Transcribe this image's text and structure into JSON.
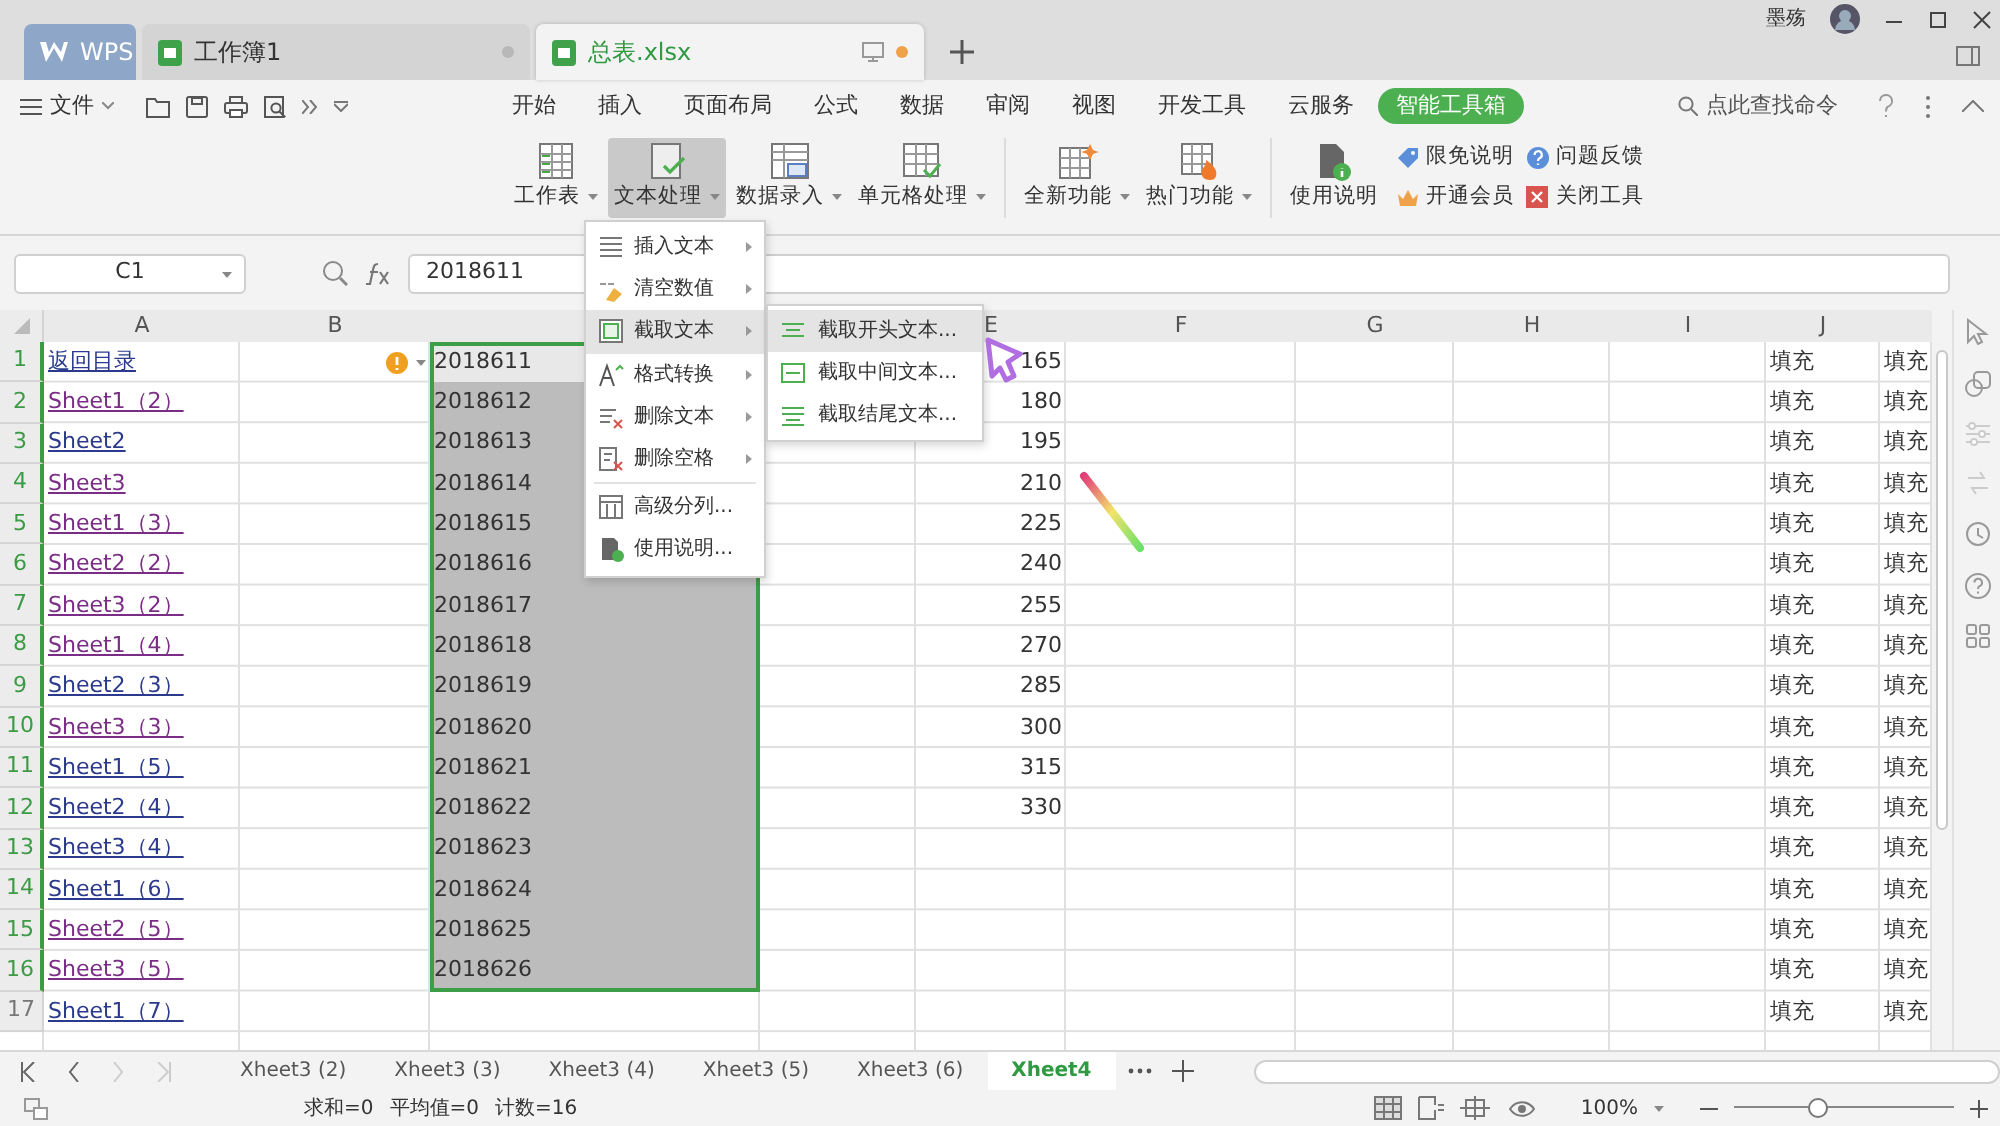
{
  "app_tabs": [
    {
      "label": "WPS",
      "kind": "home",
      "selected": false
    },
    {
      "label": "工作簿1",
      "kind": "doc",
      "selected": false,
      "unsaved": false
    },
    {
      "label": "总表.xlsx",
      "kind": "doc",
      "selected": true,
      "unsaved": true
    }
  ],
  "user": {
    "name": "墨殇"
  },
  "file_menu": {
    "label": "文件"
  },
  "ribbon_tabs": [
    {
      "label": "开始",
      "selected": false
    },
    {
      "label": "插入",
      "selected": false
    },
    {
      "label": "页面布局",
      "selected": false
    },
    {
      "label": "公式",
      "selected": false
    },
    {
      "label": "数据",
      "selected": false
    },
    {
      "label": "审阅",
      "selected": false
    },
    {
      "label": "视图",
      "selected": false
    },
    {
      "label": "开发工具",
      "selected": false
    },
    {
      "label": "云服务",
      "selected": false
    },
    {
      "label": "智能工具箱",
      "selected": true
    }
  ],
  "search": {
    "placeholder": "点此查找命令"
  },
  "ribbon_groups": [
    {
      "buttons": [
        {
          "label": "工作表",
          "kind": "sheet",
          "dropdown": true,
          "selected": false
        },
        {
          "label": "文本处理",
          "kind": "text",
          "dropdown": true,
          "selected": true
        },
        {
          "label": "数据录入",
          "kind": "entry",
          "dropdown": true,
          "selected": false
        },
        {
          "label": "单元格处理",
          "kind": "cell",
          "dropdown": true,
          "selected": false
        }
      ]
    },
    {
      "buttons": [
        {
          "label": "全新功能",
          "kind": "new",
          "dropdown": true,
          "selected": false
        },
        {
          "label": "热门功能",
          "kind": "hot",
          "dropdown": true,
          "selected": false
        }
      ]
    },
    {
      "buttons": [
        {
          "label": "使用说明",
          "kind": "help",
          "dropdown": false,
          "selected": false
        }
      ],
      "links": [
        {
          "label": "限免说明",
          "kind": "tag"
        },
        {
          "label": "问题反馈",
          "kind": "question"
        },
        {
          "label": "开通会员",
          "kind": "crown"
        },
        {
          "label": "关闭工具",
          "kind": "close"
        }
      ]
    }
  ],
  "formula_bar": {
    "cell": "C1",
    "value": "2018611"
  },
  "columns": [
    {
      "label": "A"
    },
    {
      "label": "B"
    },
    {},
    {},
    {
      "label": "E"
    },
    {
      "label": "F"
    },
    {
      "label": "G"
    },
    {
      "label": "H"
    },
    {
      "label": "I"
    },
    {
      "label": "J"
    },
    {}
  ],
  "rows": [
    {
      "number": "1",
      "selected": true,
      "cells": {
        "A": {
          "text": "返回目录",
          "visited": false
        },
        "C": "2018611",
        "E": "165",
        "J": "填充",
        "K": "填充"
      }
    },
    {
      "number": "2",
      "selected": true,
      "cells": {
        "A": {
          "text": "Sheet1（2）",
          "visited": true
        },
        "C": "2018612",
        "E": "180",
        "J": "填充",
        "K": "填充"
      }
    },
    {
      "number": "3",
      "selected": true,
      "cells": {
        "A": {
          "text": "Sheet2",
          "visited": false
        },
        "C": "2018613",
        "E": "195",
        "J": "填充",
        "K": "填充"
      }
    },
    {
      "number": "4",
      "selected": true,
      "cells": {
        "A": {
          "text": "Sheet3",
          "visited": true
        },
        "C": "2018614",
        "E": "210",
        "J": "填充",
        "K": "填充"
      }
    },
    {
      "number": "5",
      "selected": true,
      "cells": {
        "A": {
          "text": "Sheet1（3）",
          "visited": true
        },
        "C": "2018615",
        "E": "225",
        "J": "填充",
        "K": "填充"
      }
    },
    {
      "number": "6",
      "selected": true,
      "cells": {
        "A": {
          "text": "Sheet2（2）",
          "visited": true
        },
        "C": "2018616",
        "E": "240",
        "J": "填充",
        "K": "填充"
      }
    },
    {
      "number": "7",
      "selected": true,
      "cells": {
        "A": {
          "text": "Sheet3（2）",
          "visited": true
        },
        "C": "2018617",
        "E": "255",
        "J": "填充",
        "K": "填充"
      }
    },
    {
      "number": "8",
      "selected": true,
      "cells": {
        "A": {
          "text": "Sheet1（4）",
          "visited": true
        },
        "C": "2018618",
        "E": "270",
        "J": "填充",
        "K": "填充"
      }
    },
    {
      "number": "9",
      "selected": true,
      "cells": {
        "A": {
          "text": "Sheet2（3）",
          "visited": false
        },
        "C": "2018619",
        "E": "285",
        "J": "填充",
        "K": "填充"
      }
    },
    {
      "number": "10",
      "selected": true,
      "cells": {
        "A": {
          "text": "Sheet3（3）",
          "visited": true
        },
        "C": "2018620",
        "E": "300",
        "J": "填充",
        "K": "填充"
      }
    },
    {
      "number": "11",
      "selected": true,
      "cells": {
        "A": {
          "text": "Sheet1（5）",
          "visited": false
        },
        "C": "2018621",
        "E": "315",
        "J": "填充",
        "K": "填充"
      }
    },
    {
      "number": "12",
      "selected": true,
      "cells": {
        "A": {
          "text": "Sheet2（4）",
          "visited": false
        },
        "C": "2018622",
        "E": "330",
        "J": "填充",
        "K": "填充"
      }
    },
    {
      "number": "13",
      "selected": true,
      "cells": {
        "A": {
          "text": "Sheet3（4）",
          "visited": false
        },
        "C": "2018623",
        "J": "填充",
        "K": "填充"
      }
    },
    {
      "number": "14",
      "selected": true,
      "cells": {
        "A": {
          "text": "Sheet1（6）",
          "visited": false
        },
        "C": "2018624",
        "J": "填充",
        "K": "填充"
      }
    },
    {
      "number": "15",
      "selected": true,
      "cells": {
        "A": {
          "text": "Sheet2（5）",
          "visited": true
        },
        "C": "2018625",
        "J": "填充",
        "K": "填充"
      }
    },
    {
      "number": "16",
      "selected": true,
      "cells": {
        "A": {
          "text": "Sheet3（5）",
          "visited": true
        },
        "C": "2018626",
        "J": "填充",
        "K": "填充"
      }
    },
    {
      "number": "17",
      "selected": false,
      "cells": {
        "A": {
          "text": "Sheet1（7）",
          "visited": false
        },
        "J": "填充",
        "K": "填充"
      }
    }
  ],
  "context_menu": {
    "items": [
      {
        "label": "插入文本",
        "kind": "insert",
        "submenu": true,
        "selected": false
      },
      {
        "label": "清空数值",
        "kind": "clear",
        "submenu": true,
        "selected": false
      },
      {
        "label": "截取文本",
        "kind": "cut",
        "submenu": true,
        "selected": true
      },
      {
        "label": "格式转换",
        "kind": "format",
        "submenu": true,
        "selected": false
      },
      {
        "label": "删除文本",
        "kind": "delete",
        "submenu": true,
        "selected": false
      },
      {
        "label": "删除空格",
        "kind": "space",
        "submenu": true,
        "selected": false
      },
      {
        "label": "高级分列...",
        "kind": "split",
        "submenu": false,
        "selected": false
      },
      {
        "label": "使用说明...",
        "kind": "help",
        "submenu": false,
        "selected": false
      }
    ]
  },
  "submenu": {
    "items": [
      {
        "label": "截取开头文本...",
        "selected": true
      },
      {
        "label": "截取中间文本...",
        "selected": false
      },
      {
        "label": "截取结尾文本...",
        "selected": false
      }
    ]
  },
  "sheet_tabs": [
    {
      "label": "Xheet3 (2)",
      "selected": false
    },
    {
      "label": "Xheet3 (3)",
      "selected": false
    },
    {
      "label": "Xheet3 (4)",
      "selected": false
    },
    {
      "label": "Xheet3 (5)",
      "selected": false
    },
    {
      "label": "Xheet3 (6)",
      "selected": false
    },
    {
      "label": "Xheet4",
      "selected": true
    }
  ],
  "status_bar": {
    "stats": [
      "求和=0",
      "平均值=0",
      "计数=16"
    ],
    "zoom": "100%",
    "zoom_slider": {
      "level": 0.38
    }
  }
}
